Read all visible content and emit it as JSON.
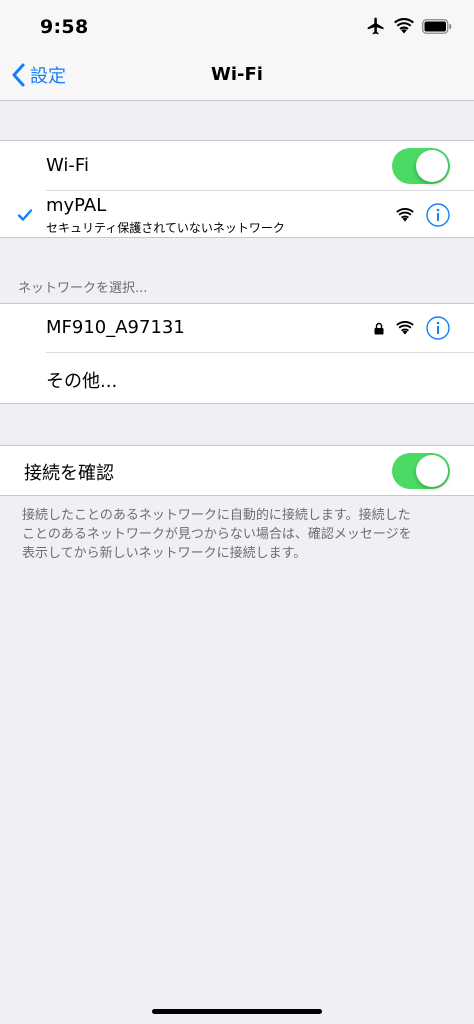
{
  "status_bar": {
    "time": "9:58"
  },
  "nav": {
    "back_label": "設定",
    "title": "Wi-Fi"
  },
  "wifi_row": {
    "label": "Wi-Fi",
    "enabled": true
  },
  "connected_network": {
    "name": "myPAL",
    "subtitle": "セキュリティ保護されていないネットワーク"
  },
  "choose_header": "ネットワークを選択...",
  "networks": [
    {
      "name": "MF910_A97131",
      "locked": true
    }
  ],
  "other_label": "その他...",
  "ask_to_join": {
    "label": "接続を確認",
    "enabled": true
  },
  "footnote_lines": [
    "接続したことのあるネットワークに自動的に接続します。接続した",
    "ことのあるネットワークが見つからない場合は、確認メッセージを",
    "表示してから新しいネットワークに接続します。"
  ],
  "colors": {
    "accent": "#147efb",
    "toggle_on": "#4cd964",
    "background": "#efeff4"
  }
}
